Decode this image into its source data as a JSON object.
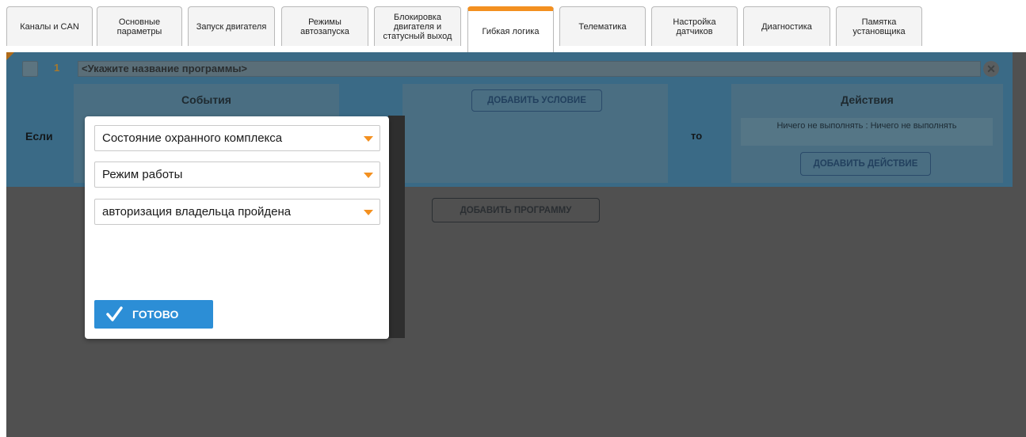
{
  "tabs": [
    {
      "label": "Каналы и CAN"
    },
    {
      "label": "Основные параметры"
    },
    {
      "label": "Запуск двигателя"
    },
    {
      "label": "Режимы автозапуска"
    },
    {
      "label": "Блокировка двигателя и статусный выход"
    },
    {
      "label": "Гибкая логика"
    },
    {
      "label": "Телематика"
    },
    {
      "label": "Настройка датчиков"
    },
    {
      "label": "Диагностика"
    },
    {
      "label": "Памятка установщика"
    }
  ],
  "active_tab": "Гибкая логика",
  "program": {
    "number": "1",
    "name_placeholder": "<Укажите название программы>",
    "if_label": "Если",
    "to_label": "то",
    "events_title": "События",
    "add_condition_label": "ДОБАВИТЬ УСЛОВИЕ",
    "actions_title": "Действия",
    "action_text": "Ничего не выполнять : Ничего не выполнять",
    "add_action_label": "ДОБАВИТЬ ДЕЙСТВИЕ"
  },
  "add_program_label": "ДОБАВИТЬ ПРОГРАММУ",
  "modal": {
    "select1": "Состояние охранного комплекса",
    "select2": "Режим работы",
    "select3": "авторизация владельца пройдена",
    "done_label": "ГОТОВО"
  },
  "colors": {
    "accent": "#f39020",
    "primary_button": "#2c8ed6",
    "overlay": "#505050"
  }
}
